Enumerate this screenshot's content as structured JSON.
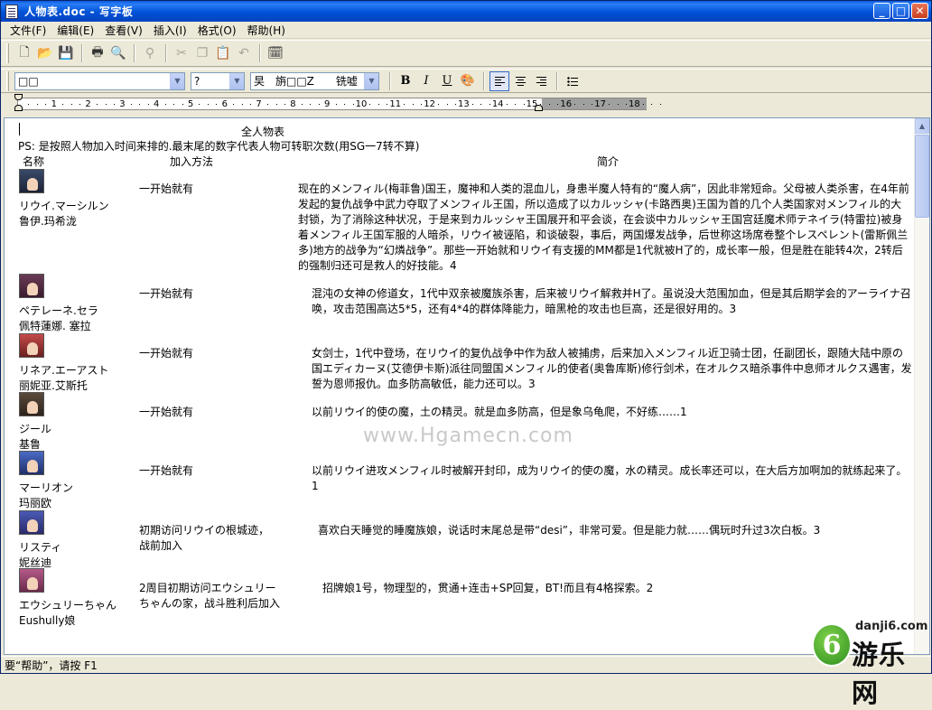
{
  "window": {
    "title": "人物表.doc - 写字板"
  },
  "menu": [
    "文件(F)",
    "编辑(E)",
    "查看(V)",
    "插入(I)",
    "格式(O)",
    "帮助(H)"
  ],
  "toolbar": {
    "icons": [
      "new-file",
      "open-folder",
      "save",
      "print",
      "print-preview",
      "find",
      "cut",
      "copy",
      "paste",
      "undo",
      "date-time"
    ]
  },
  "format": {
    "font_name": "□□",
    "font_size": "?",
    "script": "旲　旃□□Z　　铣嘘",
    "bold": "B",
    "italic": "I",
    "underline": "U"
  },
  "ruler": {
    "numbers": [
      "1",
      "2",
      "3",
      "4",
      "5",
      "6",
      "7",
      "8",
      "9",
      "10",
      "11",
      "12",
      "13",
      "14",
      "15",
      "16",
      "17",
      "18"
    ]
  },
  "doc": {
    "heading": "全人物表",
    "ps": "PS: 是按照人物加入时间来排的.最末尾的数字代表人物可转职次数(用SG一7转不算)",
    "columns": {
      "name": "名称",
      "method": "加入方法",
      "intro": "简介"
    },
    "entries": [
      {
        "name1": "リウイ.マーシルン",
        "name2": "鲁伊.玛希泷",
        "method": [
          "一开始就有"
        ],
        "desc": "现在的メンフィル(梅菲鲁)国王，魔神和人类的混血儿，身患半魔人特有的“魔人病”，因此非常短命。父母被人类杀害，在4年前发起的复仇战争中武力夺取了メンフィル王国，所以造成了以カルッシャ(卡路西奥)王国为首的几个人类国家对メンフィル的大封锁，为了消除这种状况，于是来到カルッシャ王国展开和平会谈，在会谈中カルッシャ王国宫廷魔术师テネイラ(特雷拉)被身着メンフィル王国军服的人暗杀，リウイ被诬陷，和谈破裂，事后，两国爆发战争，后世称这场席卷整个レスペレント(雷斯佩兰多)地方的战争为“幻燐战争”。那些一开始就和リウイ有支援的MM都是1代就被H了的，成长率一般，但是胜在能转4次，2转后的强制归还可是救人的好技能。4"
      },
      {
        "name1": "ペテレーネ.セラ",
        "name2": "佩特蓮娜. 塞拉",
        "method": [
          "一开始就有"
        ],
        "desc": "混沌の女神の修道女，1代中双亲被魔族杀害，后来被リウイ解救并H了。虽说没大范围加血，但是其后期学会的アーライナ召唤，攻击范围高达5*5，还有4*4的群体降能力，暗黑枪的攻击也巨高，还是很好用的。3"
      },
      {
        "name1": "リネア.エーアスト",
        "name2": "丽妮亚.艾斯托",
        "method": [
          "一开始就有"
        ],
        "desc": "女剑士，1代中登场，在リウイ的复仇战争中作为敌人被捕虏，后来加入メンフィル近卫骑士团，任副团长，跟随大陆中原の国エディカーヌ(艾德伊卡斯)派往同盟国メンフィル的使者(奥鲁库斯)修行剑术，在オルクス暗杀事件中息师オルクス遇害，发誓为恩师报仇。血多防高敏低，能力还可以。3"
      },
      {
        "name1": "ジール",
        "name2": "基鲁",
        "method": [
          "一开始就有"
        ],
        "desc": "以前リウイ的使の魔，土の精灵。就是血多防高，但是象乌龟爬，不好练……1"
      },
      {
        "name1": "マーリオン",
        "name2": "玛丽欧",
        "method": [
          "一开始就有"
        ],
        "desc": "以前リウイ进攻メンフィル时被解开封印，成为リウイ的使の魔，水の精灵。成长率还可以，在大后方加啊加的就练起来了。1"
      },
      {
        "name1": "リスティ",
        "name2": "妮丝迪",
        "method": [
          "初期访问リウイの根城迹，",
          "战前加入"
        ],
        "desc": "喜欢白天睡觉的睡魔族娘，说话时末尾总是带“desi”，非常可爱。但是能力就……偶玩时升过3次白板。3"
      },
      {
        "name1": "エウシュリーちゃん",
        "name2": "Eushully娘",
        "method": [
          "2周目初期访问エウシュリー",
          "ちゃんの家，战斗胜利后加入"
        ],
        "desc": "招牌娘1号，物理型的，贯通+连击+SP回复，BT!而且有4格探索。2"
      }
    ],
    "watermark": "www.Hgamecn.com"
  },
  "status": {
    "text": "要“帮助”，请按 F1"
  },
  "logo": {
    "url": "danji6.com",
    "name": "游乐网",
    "badge": "6"
  },
  "colors": {
    "titlebar": "#0052d6",
    "chrome": "#ece9d8",
    "border": "#7f9db9"
  }
}
